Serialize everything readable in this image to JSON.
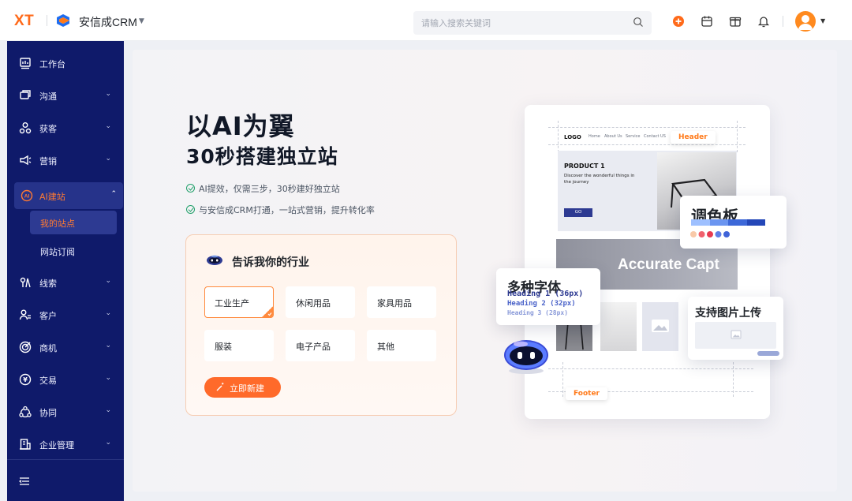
{
  "header": {
    "brand_mark": "XT",
    "app_name": "安信成CRM",
    "search_placeholder": "请输入搜索关键词"
  },
  "sidebar": {
    "items": [
      {
        "label": "工作台",
        "icon": "dashboard-icon"
      },
      {
        "label": "沟通",
        "icon": "chat-icon"
      },
      {
        "label": "获客",
        "icon": "acquire-icon"
      },
      {
        "label": "营销",
        "icon": "megaphone-icon"
      },
      {
        "label": "AI建站",
        "icon": "ai-site-icon"
      },
      {
        "label": "线索",
        "icon": "leads-icon"
      },
      {
        "label": "客户",
        "icon": "customers-icon"
      },
      {
        "label": "商机",
        "icon": "opportunity-icon"
      },
      {
        "label": "交易",
        "icon": "transaction-icon"
      },
      {
        "label": "协同",
        "icon": "collaboration-icon"
      },
      {
        "label": "企业管理",
        "icon": "enterprise-icon"
      }
    ],
    "sub_items": [
      "我的站点",
      "网站订阅"
    ],
    "active_sub": "我的站点"
  },
  "main": {
    "title": "以AI为翼",
    "subtitle": "30秒搭建独立站",
    "features": [
      "AI提效，仅需三步，30秒建好独立站",
      "与安信成CRM打通，一站式营销，提升转化率"
    ],
    "panel_title": "告诉我你的行业",
    "categories": [
      "工业生产",
      "休闲用品",
      "家具用品",
      "服装",
      "电子产品",
      "其他"
    ],
    "selected_category": "工业生产",
    "create_button": "立即新建"
  },
  "illustration": {
    "mini_logo": "LOGO",
    "mini_nav": [
      "Home",
      "About Us",
      "Service",
      "Contact US"
    ],
    "header_tag": "Header",
    "footer_tag": "Footer",
    "product_title": "PRODUCT 1",
    "product_sub": "Discover the wonderful things in the journey",
    "go_label": "GO",
    "caption": "Accurate Capt",
    "palette_title": "调色板",
    "font_title": "多种字体",
    "font_lines": [
      "Heading 1 (36px)",
      "Heading 2 (32px)",
      "Heading 3 (28px)"
    ],
    "upload_title": "支持图片上传",
    "palette_colors": [
      "#f8c9a8",
      "#f0616d",
      "#e83a50",
      "#5f7fe6",
      "#3f63d8"
    ],
    "accent": "#ff6a2a",
    "sidebar_color": "#0f1a6a"
  }
}
